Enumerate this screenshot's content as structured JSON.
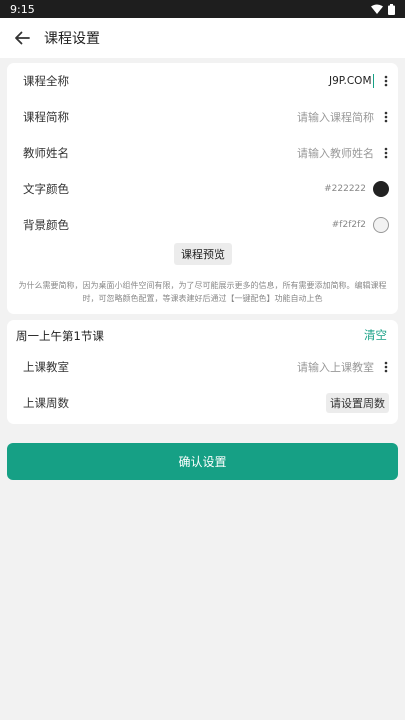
{
  "status_bar": {
    "time": "9:15"
  },
  "app_bar": {
    "title": "课程设置"
  },
  "course": {
    "full_name_label": "课程全称",
    "full_name_value": "J9P.COM",
    "short_name_label": "课程简称",
    "short_name_placeholder": "请输入课程简称",
    "teacher_label": "教师姓名",
    "teacher_placeholder": "请输入教师姓名",
    "text_color_label": "文字颜色",
    "text_color_value": "#222222",
    "bg_color_label": "背景颜色",
    "bg_color_value": "#f2f2f2",
    "preview_label": "课程预览",
    "hint": "为什么需要简称，因为桌面小组件空间有限，为了尽可能展示更多的信息，所有需要添加简称。编辑课程时，可忽略颜色配置，等课表建好后通过【一键配色】功能自动上色"
  },
  "slot": {
    "title": "周一上午第1节课",
    "clear_label": "清空",
    "classroom_label": "上课教室",
    "classroom_placeholder": "请输入上课教室",
    "weeks_label": "上课周数",
    "weeks_button": "请设置周数"
  },
  "confirm_label": "确认设置",
  "colors": {
    "accent": "#16a085",
    "text_color": "#222222",
    "bg_color": "#f2f2f2"
  }
}
